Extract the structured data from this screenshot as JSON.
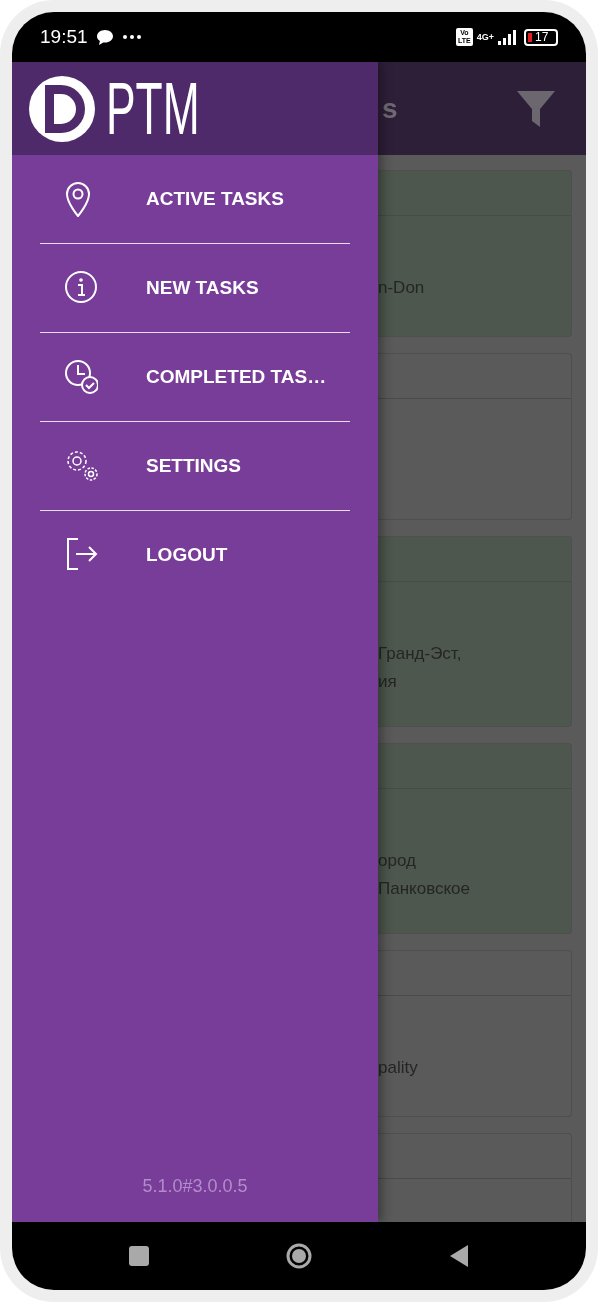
{
  "status_bar": {
    "time": "19:51",
    "volte": [
      "Vo",
      "LTE"
    ],
    "network": "4G+",
    "battery": "17"
  },
  "app_bar": {
    "title": "s"
  },
  "tasks": [
    {
      "color": "#4d574d",
      "lines": [
        "n-Don"
      ]
    },
    {
      "color": "#5a5a5a"
    },
    {
      "color": "#4d574d",
      "lines": [
        "Гранд-Эст,",
        "ия"
      ]
    },
    {
      "color": "#4d574d",
      "lines": [
        "ород",
        "Панковское"
      ]
    },
    {
      "color": "#5a5a5a",
      "lines": [
        "pality"
      ]
    },
    {
      "color": "#5a5a5a"
    }
  ],
  "drawer": {
    "brand": "PTM",
    "items": [
      {
        "label": "ACTIVE TASKS",
        "kind": "pin"
      },
      {
        "label": "NEW TASKS",
        "kind": "info"
      },
      {
        "label": "COMPLETED TAS…",
        "kind": "clock"
      },
      {
        "label": "SETTINGS",
        "kind": "gears"
      },
      {
        "label": "LOGOUT",
        "kind": "logout"
      }
    ],
    "version": "5.1.0#3.0.0.5"
  }
}
